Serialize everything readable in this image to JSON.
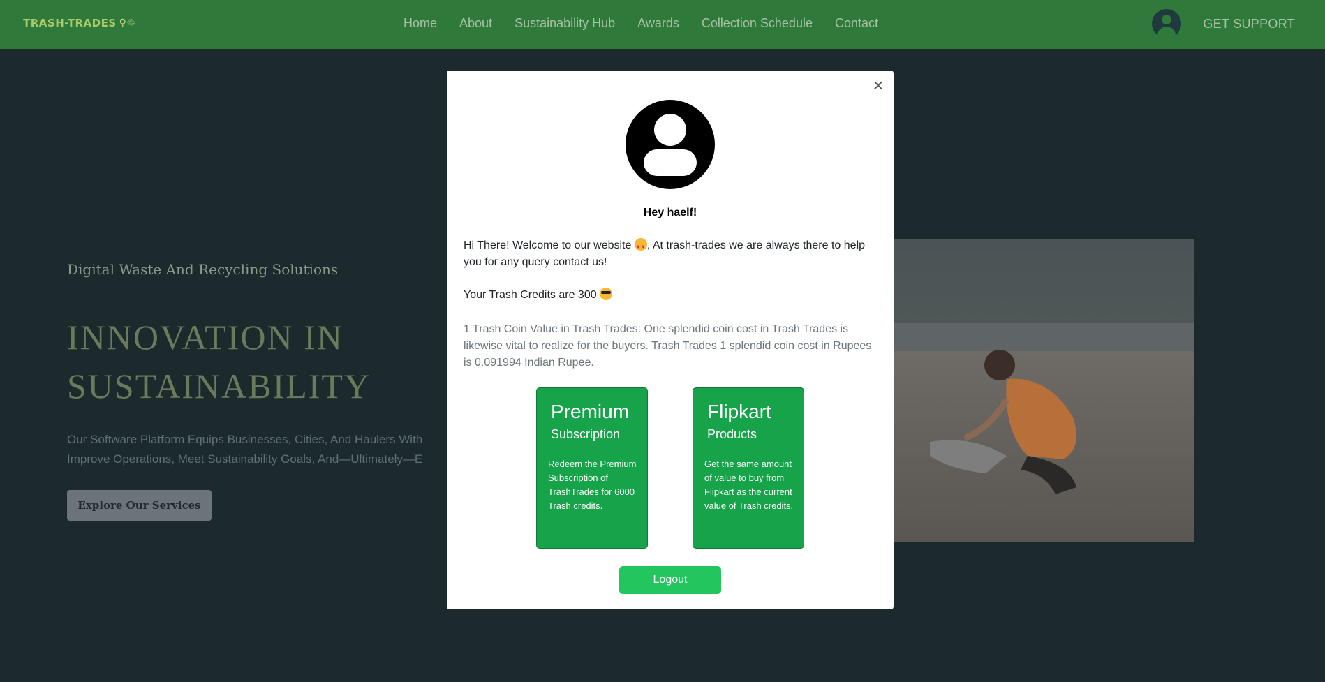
{
  "navbar": {
    "logo_text": "TRASH-TRADES",
    "logo_icon": "recycle-people-icon",
    "links": [
      "Home",
      "About",
      "Sustainability Hub",
      "Awards",
      "Collection Schedule",
      "Contact"
    ],
    "support_label": "GET SUPPORT",
    "brand_color": "#2f7a3a"
  },
  "hero": {
    "kicker": "Digital Waste And Recycling Solutions",
    "title": "INNOVATION IN SUSTAINABILITY",
    "description": "Our Software Platform Equips Businesses, Cities, And Haulers With\nImprove Operations, Meet Sustainability Goals, And—Ultimately—E",
    "button_label": "Explore Our Services"
  },
  "modal": {
    "greeting": "Hey haelf!",
    "welcome_part1": "Hi There! Welcome to our website",
    "welcome_part2": ", At trash-trades we are always there to help you for any query contact us!",
    "credits_text": "Your Trash Credits are 300",
    "coin_info": "1 Trash Coin Value in Trash Trades: One splendid coin cost in Trash Trades is likewise vital to realize for the buyers. Trash Trades 1 splendid coin cost in Rupees is 0.091994 Indian Rupee.",
    "cards": [
      {
        "title": "Premium",
        "subtitle": "Subscription",
        "text": "Redeem the Premium Subscription of TrashTrades for 6000 Trash credits."
      },
      {
        "title": "Flipkart",
        "subtitle": "Products",
        "text": "Get the same amount of value to buy from Flipkart as the current value of Trash credits."
      }
    ],
    "logout_label": "Logout",
    "close_glyph": "×",
    "card_color": "#16a34a",
    "logout_color": "#22c55e"
  }
}
